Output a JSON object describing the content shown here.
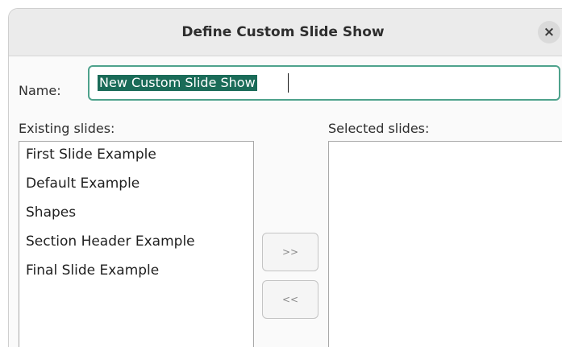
{
  "window": {
    "title": "Define Custom Slide Show",
    "close_icon": "×"
  },
  "name_field": {
    "label": "Name:",
    "value": "New Custom Slide Show"
  },
  "existing": {
    "label": "Existing slides:",
    "items": [
      "First Slide Example",
      "Default Example",
      "Shapes",
      "Section Header Example",
      "Final Slide Example"
    ]
  },
  "selected": {
    "label": "Selected slides:",
    "items": []
  },
  "buttons": {
    "add": ">>",
    "remove": "<<"
  },
  "colors": {
    "accent": "#4ea28c",
    "selection": "#1a6b58"
  }
}
